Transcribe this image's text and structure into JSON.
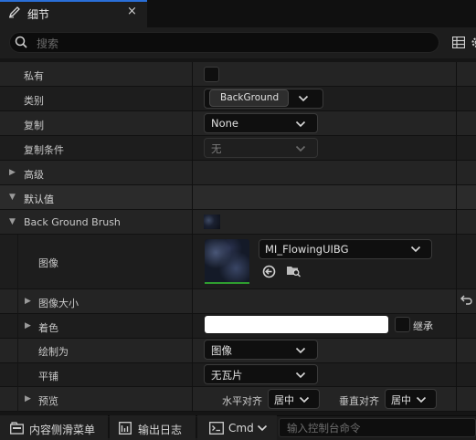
{
  "tab": {
    "title": "细节",
    "close": "×"
  },
  "search": {
    "placeholder": "搜索"
  },
  "rows": {
    "private": {
      "label": "私有"
    },
    "category": {
      "label": "类别",
      "value": "BackGround"
    },
    "replication": {
      "label": "复制",
      "value": "None"
    },
    "replication_condition": {
      "label": "复制条件",
      "value": "无"
    },
    "advanced": {
      "label": "高级"
    },
    "default_value": {
      "label": "默认值"
    },
    "brush": {
      "label": "Back Ground Brush"
    },
    "image": {
      "label": "图像",
      "value": "MI_FlowingUIBG"
    },
    "image_size": {
      "label": "图像大小"
    },
    "tint": {
      "label": "着色",
      "inherit": "继承"
    },
    "draw_as": {
      "label": "绘制为",
      "value": "图像"
    },
    "tiling": {
      "label": "平铺",
      "value": "无瓦片"
    },
    "preview": {
      "label": "预览",
      "h_align_label": "水平对齐",
      "h_align_value": "居中",
      "v_align_label": "垂直对齐",
      "v_align_value": "居中"
    }
  },
  "bottom": {
    "content_drawer": "内容侧滑菜单",
    "output_log": "输出日志",
    "cmd": "Cmd",
    "console_placeholder": "输入控制台命令"
  },
  "colors": {
    "accent_blue": "#2a6fd8",
    "thumbnail_underline": "#2f9e2f",
    "tint_swatch": "#ffffff"
  }
}
